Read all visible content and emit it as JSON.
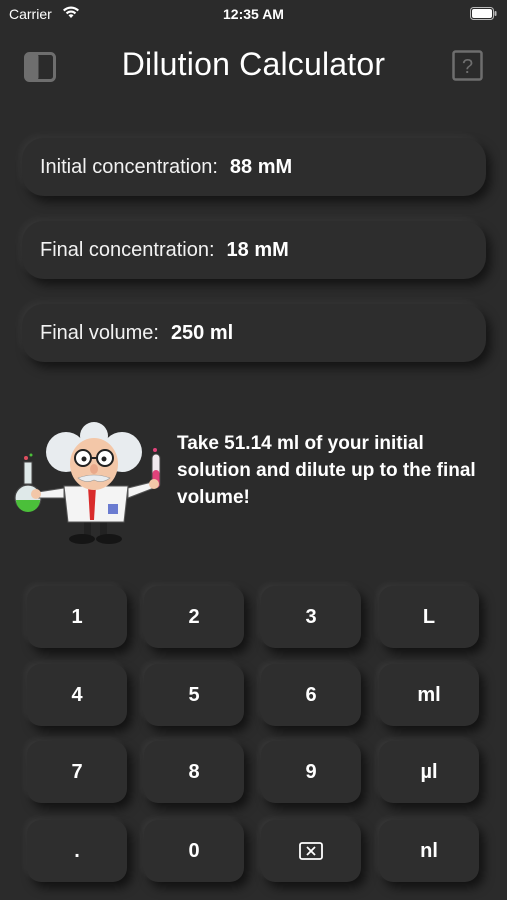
{
  "status_bar": {
    "carrier": "Carrier",
    "time": "12:35 AM"
  },
  "header": {
    "title": "Dilution Calculator",
    "sidebar_icon": "sidebar-toggle-icon",
    "help_icon": "question-mark-icon",
    "help_symbol": "?"
  },
  "fields": [
    {
      "label": "Initial concentration:",
      "value": "88 mM"
    },
    {
      "label": "Final concentration:",
      "value": "18 mM"
    },
    {
      "label": "Final volume:",
      "value": "250 ml"
    }
  ],
  "result": {
    "text": "Take 51.14 ml of your initial solution and dilute up to the final volume!",
    "illustration": "scientist-illustration"
  },
  "keypad": {
    "keys": [
      "1",
      "2",
      "3",
      "L",
      "4",
      "5",
      "6",
      "ml",
      "7",
      "8",
      "9",
      "µl",
      ".",
      "0",
      "",
      "nl"
    ],
    "backspace_icon": "backspace-icon"
  },
  "colors": {
    "background": "#2b2b2b",
    "text": "#ffffff",
    "icon_gray": "#6e6e6e"
  }
}
